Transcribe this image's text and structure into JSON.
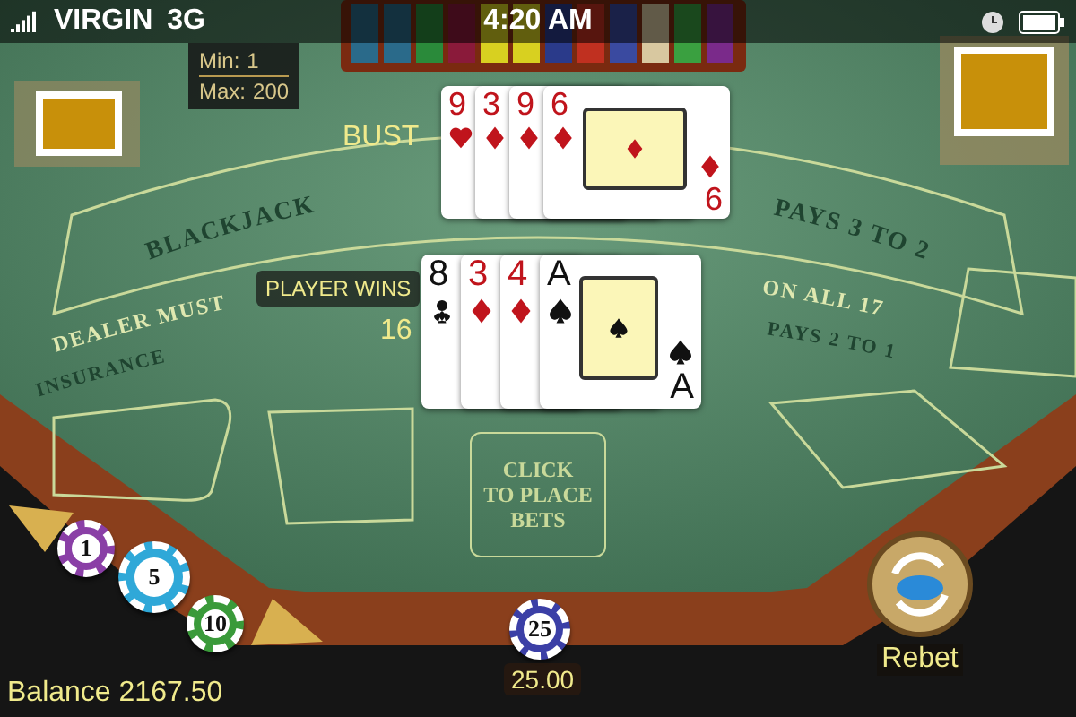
{
  "status_bar": {
    "carrier": "VIRGIN",
    "network": "3G",
    "time": "4:20 AM"
  },
  "limits": {
    "min_label": "Min:",
    "min": "1",
    "max_label": "Max:",
    "max": "200"
  },
  "table_rules": [
    {
      "left": "BLACKJACK",
      "right": "PAYS 3 TO 2"
    },
    {
      "left": "DEALER MUST",
      "right": "ON ALL 17"
    },
    {
      "left": "INSURANCE",
      "right": "PAYS 2 TO 1"
    }
  ],
  "dealer": {
    "result": "BUST",
    "cards": [
      {
        "rank": "9",
        "kind": "hearts"
      },
      {
        "rank": "3",
        "kind": "diamonds"
      },
      {
        "rank": "9",
        "kind": "diamonds"
      },
      {
        "rank": "6",
        "kind": "diamonds",
        "bottom_rank": "6"
      }
    ]
  },
  "player": {
    "result": "PLAYER WINS",
    "total": "16",
    "cards": [
      {
        "rank": "8",
        "kind": "clubs"
      },
      {
        "rank": "3",
        "kind": "diamonds"
      },
      {
        "rank": "4",
        "kind": "diamonds"
      },
      {
        "rank": "A",
        "kind": "spades",
        "bottom_rank": "A"
      }
    ]
  },
  "bet_spot": {
    "lines": [
      "CLICK",
      "TO PLACE",
      "BETS"
    ]
  },
  "chips": [
    {
      "value": "1",
      "color": "#8a3fa6"
    },
    {
      "value": "5",
      "color": "#2fa8d8"
    },
    {
      "value": "10",
      "color": "#3a9a3a"
    }
  ],
  "bet": {
    "chip": "25",
    "color": "#3b3fa6",
    "amount": "25.00"
  },
  "rebet": {
    "label": "Rebet"
  },
  "balance": {
    "label": "Balance",
    "value": "2167.50"
  }
}
